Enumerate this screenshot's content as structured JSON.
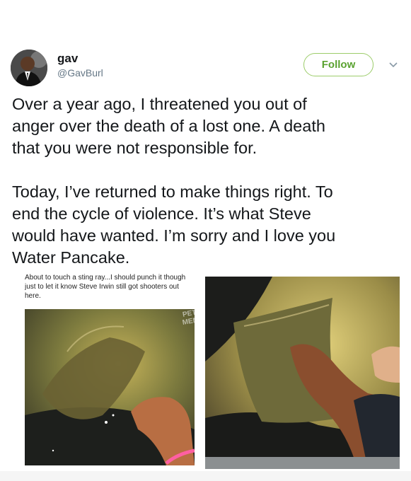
{
  "author": {
    "name": "gav",
    "handle": "@GavBurl"
  },
  "follow_button": {
    "label": "Follow"
  },
  "icons": {
    "caret": "chevron-down-icon"
  },
  "tweet": {
    "text": "Over a year ago, I threatened you out of\nanger over the death of a lost one. A death\nthat you were not responsible for.\n\nToday, I’ve returned to make things right. To\nend the cycle of violence. It’s what Steve\nwould have wanted. I’m sorry and I love you\nWater Pancake."
  },
  "meme": {
    "caption": "About to touch a sting ray...I should punch it though just to let it know Steve Irwin still got shooters out here.",
    "watermark": "PETTY MEMES"
  },
  "colors": {
    "follow_accent": "#5aa230",
    "follow_border": "#9ccc6a",
    "handle_gray": "#657786"
  }
}
